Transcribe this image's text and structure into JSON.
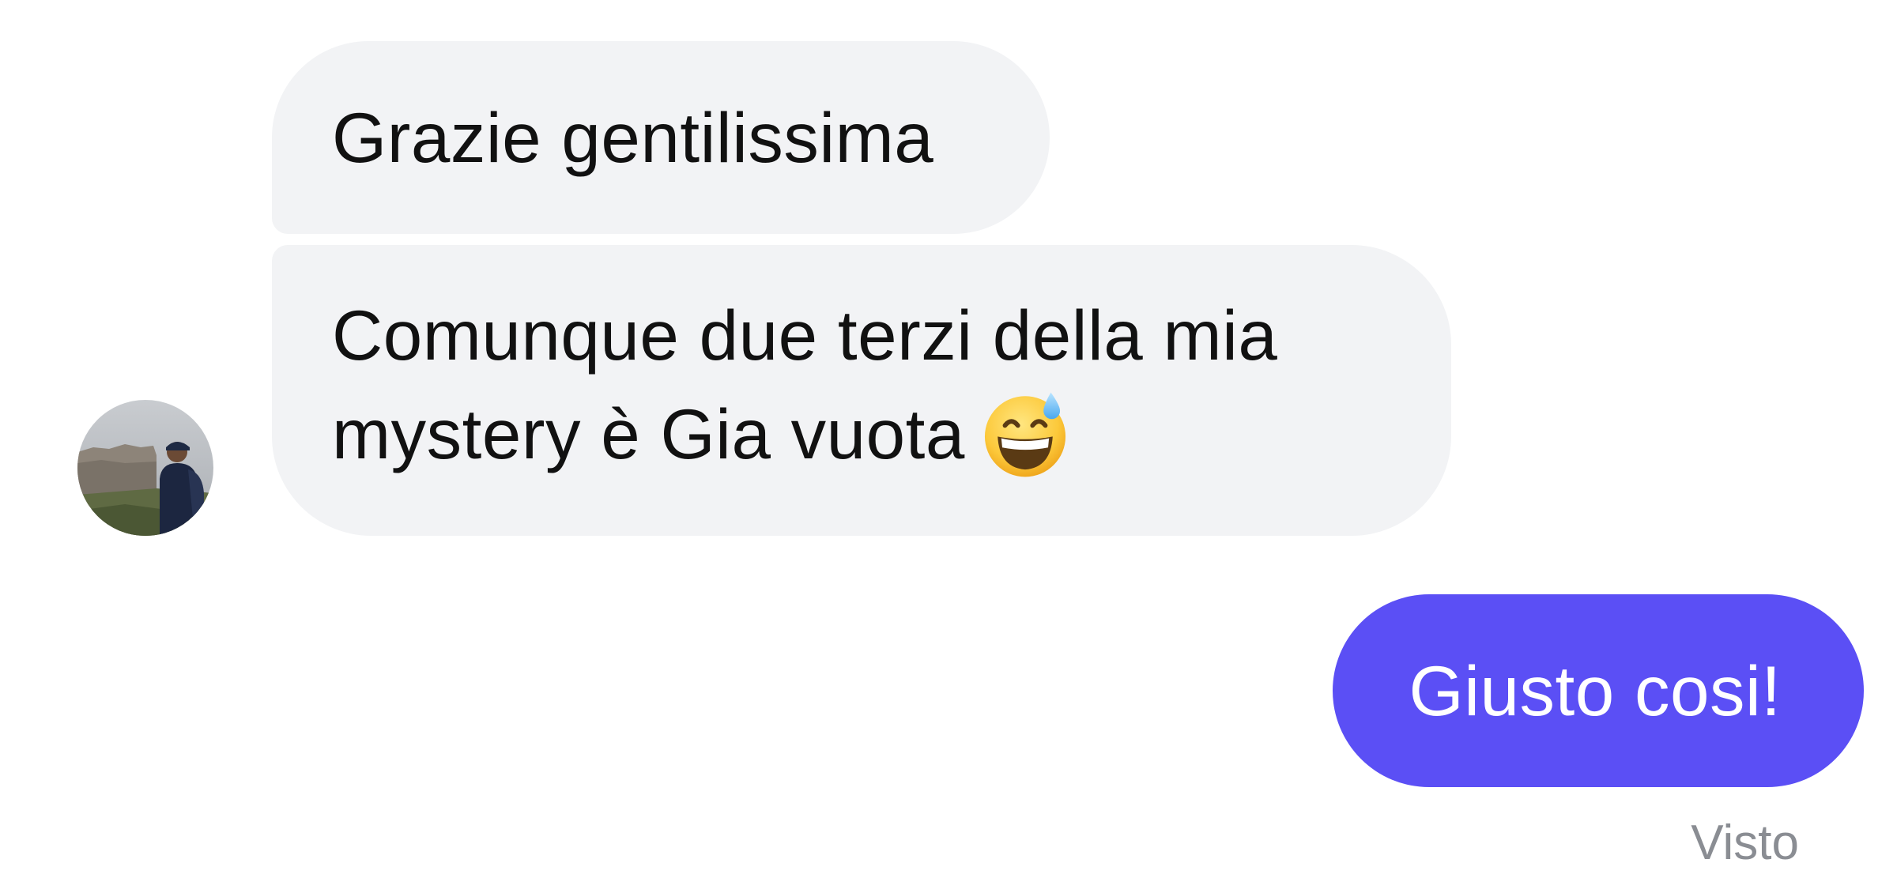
{
  "conversation": {
    "messages": [
      {
        "direction": "incoming",
        "text": "Grazie gentilissima"
      },
      {
        "direction": "incoming",
        "line1": "Comunque due terzi della mia",
        "line2": "mystery è Gia vuota",
        "emoji": "grinning-face-with-sweat"
      },
      {
        "direction": "outgoing",
        "text": "Giusto cosi!"
      }
    ],
    "seen_label": "Visto"
  },
  "colors": {
    "incoming_bubble": "#f2f3f5",
    "outgoing_bubble": "#5b4ff5",
    "text_dark": "#111111",
    "seen_text": "#8a8d93"
  },
  "icons": {
    "avatar": "user-avatar-photo",
    "emoji": "grinning-face-with-sweat-icon"
  }
}
